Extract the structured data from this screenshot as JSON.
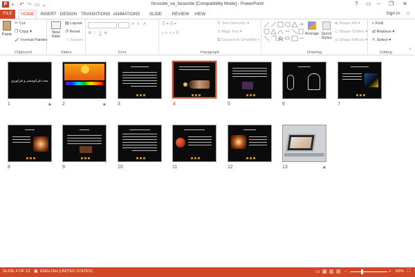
{
  "window": {
    "title": "forosote_va_faraosite [Compatibility Mode] - PowerPoint",
    "controls": [
      "?",
      "▭",
      "−",
      "❐",
      "✕"
    ]
  },
  "tabs": [
    {
      "label": "FILE"
    },
    {
      "label": "HOME"
    },
    {
      "label": "INSERT"
    },
    {
      "label": "DESIGN"
    },
    {
      "label": "TRANSITIONS"
    },
    {
      "label": "ANIMATIONS"
    },
    {
      "label": "SLIDE SHOW"
    },
    {
      "label": "REVIEW"
    },
    {
      "label": "VIEW"
    }
  ],
  "signin": "Sign in",
  "ribbon": {
    "clipboard": {
      "paste": "Paste",
      "cut": "Cut",
      "copy": "Copy",
      "format_painter": "Format Painter",
      "label": "Clipboard"
    },
    "slides": {
      "new_slide": "New",
      "new_slide2": "Slide",
      "layout": "Layout",
      "reset": "Reset",
      "section": "Section",
      "label": "Slides"
    },
    "font": {
      "label": "Font",
      "bold": "B",
      "italic": "I",
      "underline": "U",
      "strike": "S",
      "size_up": "A",
      "size_down": "A",
      "clear": "A"
    },
    "paragraph": {
      "label": "Paragraph",
      "text_direction": "Text Direction",
      "align_text": "Align Text",
      "smartart": "Convert to SmartArt"
    },
    "drawing": {
      "label": "Drawing",
      "arrange": "Arrange",
      "quick_styles": "Quick",
      "quick_styles2": "Styles",
      "shape_fill": "Shape Fill",
      "shape_outline": "Shape Outline",
      "shape_effects": "Shape Effects"
    },
    "editing": {
      "label": "Editing",
      "find": "Find",
      "replace": "Replace",
      "select": "Select"
    }
  },
  "slides": [
    {
      "num": "1",
      "star": "★"
    },
    {
      "num": "2",
      "star": "★"
    },
    {
      "num": "3",
      "star": ""
    },
    {
      "num": "4",
      "star": ""
    },
    {
      "num": "5",
      "star": ""
    },
    {
      "num": "6",
      "star": ""
    },
    {
      "num": "7",
      "star": ""
    },
    {
      "num": "8",
      "star": ""
    },
    {
      "num": "9",
      "star": ""
    },
    {
      "num": "10",
      "star": ""
    },
    {
      "num": "11",
      "star": ""
    },
    {
      "num": "12",
      "star": ""
    },
    {
      "num": "13",
      "star": "★"
    }
  ],
  "slide1_title": "دو بحث فرآنوسحر و فرآیوری",
  "status": {
    "slide_of": "SLIDE 4 OF 13",
    "language": "ENGLISH (UNITED STATES)",
    "zoom": "60%",
    "zoom_fraction": 0.6
  },
  "colors": {
    "accent": "#d24726",
    "slide_bg": "#0b0b0b"
  }
}
